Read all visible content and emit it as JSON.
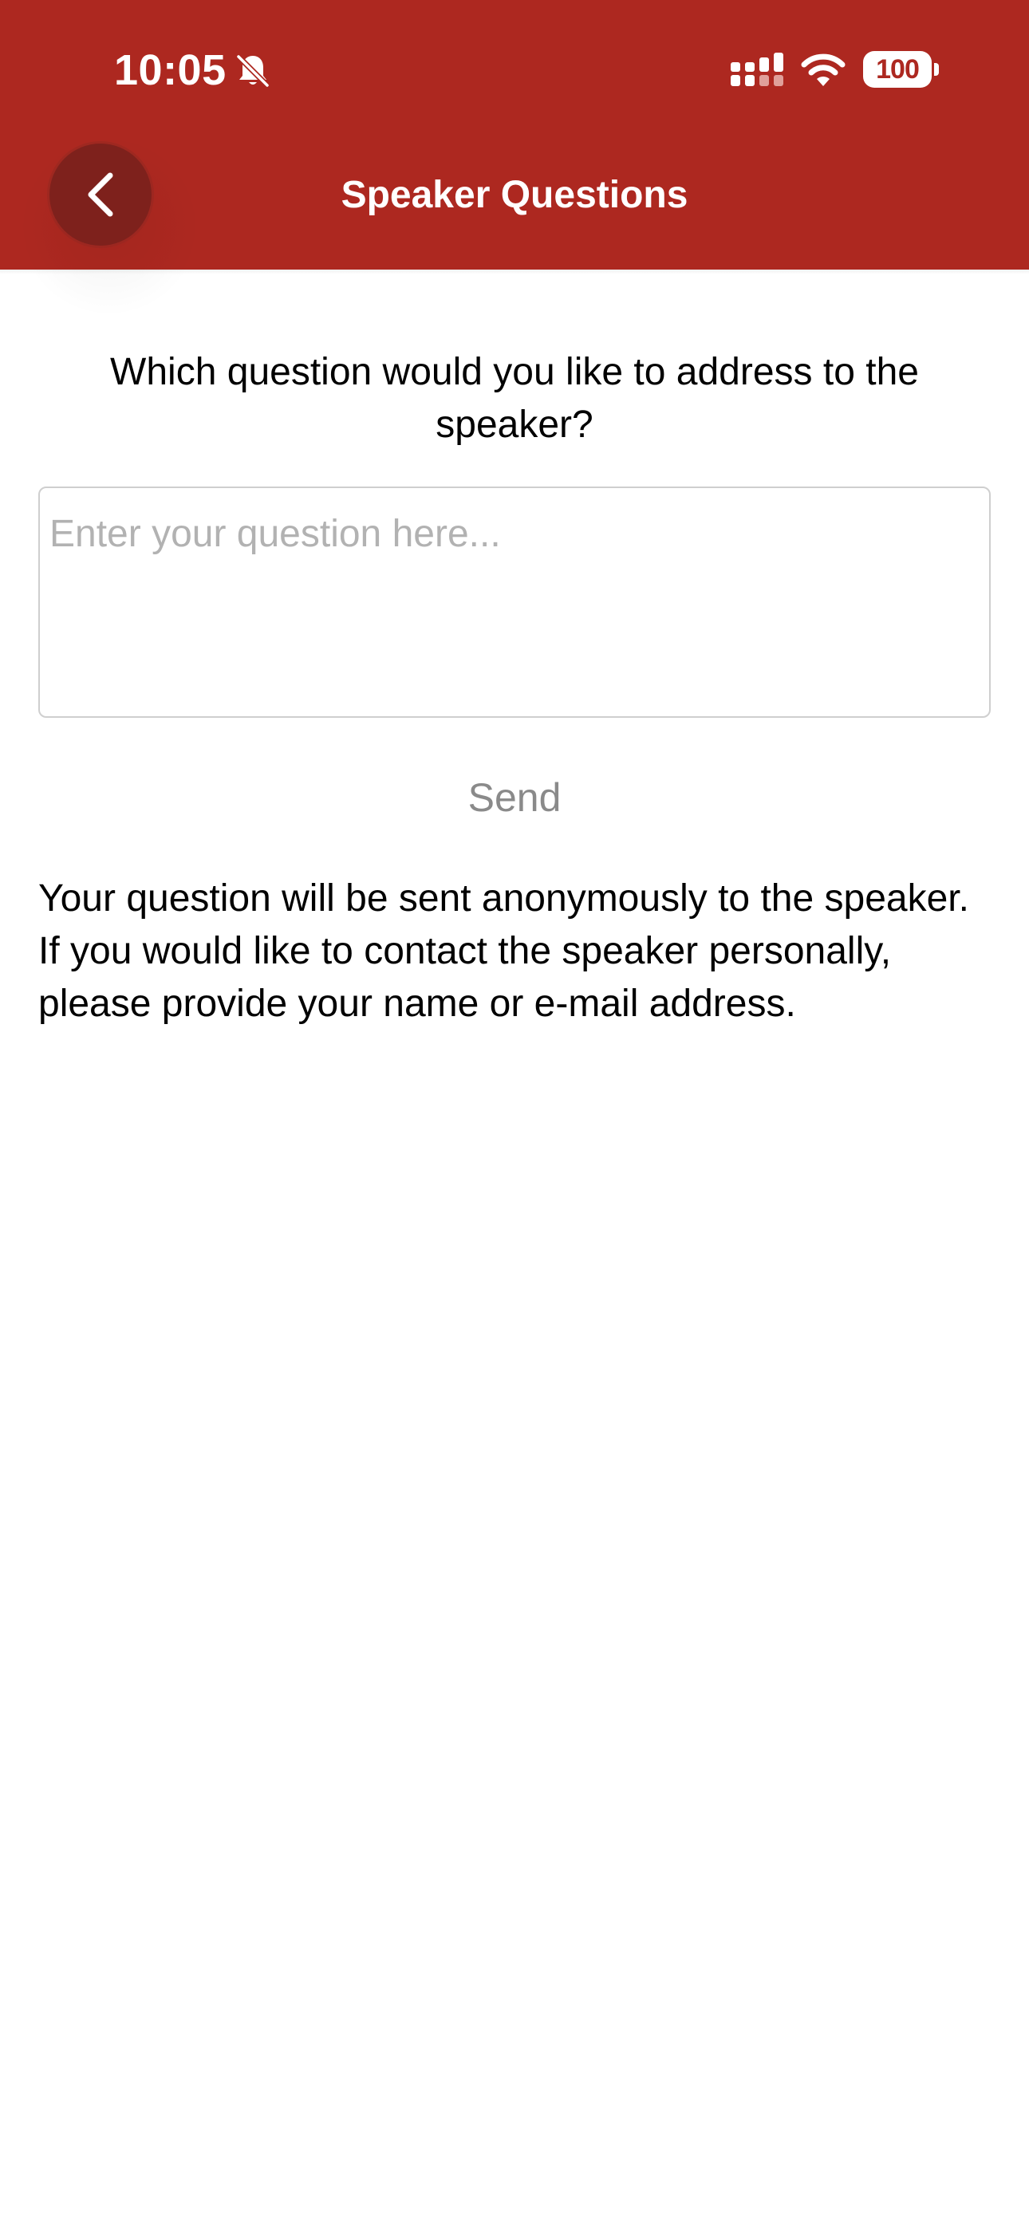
{
  "colors": {
    "header": "#ad2820",
    "back_button": "#7e211c",
    "placeholder": "#b2b2b2",
    "send_disabled": "#8a8a8a"
  },
  "status_bar": {
    "time": "10:05",
    "battery": "100",
    "icons": [
      "bell-slash-icon",
      "signal-icon",
      "wifi-icon",
      "battery-icon"
    ]
  },
  "header": {
    "title": "Speaker Questions",
    "back_icon": "chevron-left-icon"
  },
  "form": {
    "prompt": "Which question would you like to address to the speaker?",
    "input_value": "",
    "input_placeholder": "Enter your question here...",
    "send_label": "Send",
    "info": "Your question will be sent anonymously to the speaker. If you would like to contact the speaker personally, please provide your name or e-mail address."
  }
}
